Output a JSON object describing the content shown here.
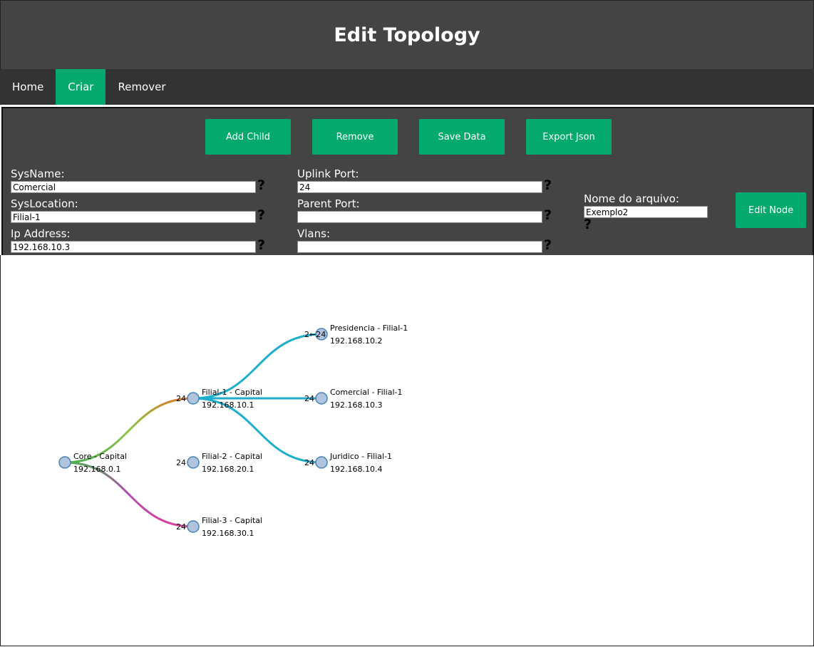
{
  "header": {
    "title": "Edit Topology"
  },
  "nav": {
    "items": [
      {
        "label": "Home",
        "active": false
      },
      {
        "label": "Criar",
        "active": true
      },
      {
        "label": "Remover",
        "active": false
      }
    ]
  },
  "toolbar": {
    "add_child": "Add Child",
    "remove": "Remove",
    "save_data": "Save Data",
    "export_json": "Export Json",
    "edit_node": "Edit Node"
  },
  "form": {
    "sysname_label": "SysName:",
    "sysname_value": "Comercial",
    "syslocation_label": "SysLocation:",
    "syslocation_value": "Filial-1",
    "ip_label": "Ip Address:",
    "ip_value": "192.168.10.3",
    "uplink_label": "Uplink Port:",
    "uplink_value": "24",
    "parent_label": "Parent Port:",
    "parent_value": "",
    "vlans_label": "Vlans:",
    "vlans_value": "",
    "filename_label": "Nome do arquivo:",
    "filename_value": "Exemplo2",
    "help": "?"
  },
  "colors": {
    "accent": "#04aa6d",
    "link": "#1eaecc",
    "node_fill": "#b0c4de",
    "node_stroke": "#4682b4"
  },
  "topology": {
    "nodes": [
      {
        "id": "core",
        "name": "Core - Capital",
        "ip": "192.168.0.1",
        "port": ""
      },
      {
        "id": "f1",
        "name": "Filial-1 - Capital",
        "ip": "192.168.10.1",
        "port": "24"
      },
      {
        "id": "f2",
        "name": "Filial-2 - Capital",
        "ip": "192.168.20.1",
        "port": "24"
      },
      {
        "id": "f3",
        "name": "Filial-3 - Capital",
        "ip": "192.168.30.1",
        "port": "24"
      },
      {
        "id": "pres",
        "name": "Presidencia - Filial-1",
        "ip": "192.168.10.2",
        "port": "2←24"
      },
      {
        "id": "com",
        "name": "Comercial - Filial-1",
        "ip": "192.168.10.3",
        "port": "24"
      },
      {
        "id": "jur",
        "name": "Juridico - Filial-1",
        "ip": "192.168.10.4",
        "port": "24"
      }
    ]
  }
}
